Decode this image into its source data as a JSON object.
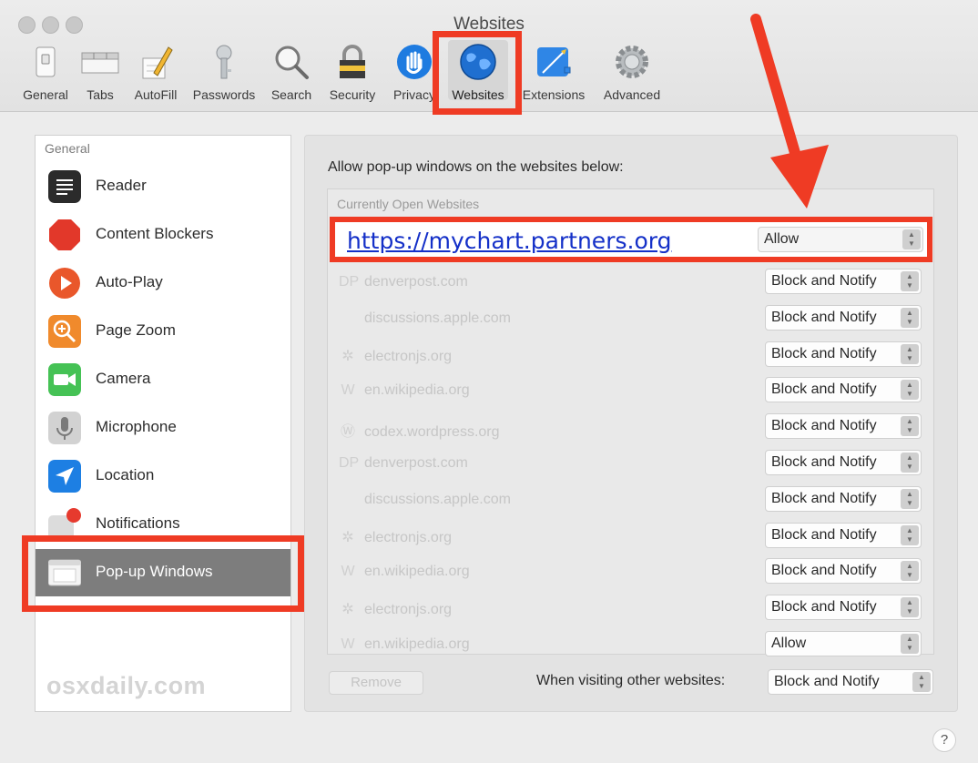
{
  "window": {
    "title": "Websites"
  },
  "toolbar": {
    "items": [
      {
        "label": "General",
        "icon": "general-switch-icon"
      },
      {
        "label": "Tabs",
        "icon": "tabs-icon"
      },
      {
        "label": "AutoFill",
        "icon": "pencil-form-icon"
      },
      {
        "label": "Passwords",
        "icon": "key-icon"
      },
      {
        "label": "Search",
        "icon": "magnifier-icon"
      },
      {
        "label": "Security",
        "icon": "lock-icon"
      },
      {
        "label": "Privacy",
        "icon": "hand-icon"
      },
      {
        "label": "Websites",
        "icon": "globe-icon",
        "selected": true
      },
      {
        "label": "Extensions",
        "icon": "puzzle-compass-icon"
      },
      {
        "label": "Advanced",
        "icon": "gear-icon"
      }
    ]
  },
  "sidebar": {
    "header": "General",
    "items": [
      {
        "label": "Reader",
        "icon": "reader-icon",
        "color": "#2b2b2b"
      },
      {
        "label": "Content Blockers",
        "icon": "stop-sign-icon",
        "color": "#e2382a"
      },
      {
        "label": "Auto-Play",
        "icon": "play-icon",
        "color": "#e9572b"
      },
      {
        "label": "Page Zoom",
        "icon": "zoom-icon",
        "color": "#f08a2c"
      },
      {
        "label": "Camera",
        "icon": "camera-icon",
        "color": "#45c255"
      },
      {
        "label": "Microphone",
        "icon": "microphone-icon",
        "color": "#c9c9c9"
      },
      {
        "label": "Location",
        "icon": "location-arrow-icon",
        "color": "#1d7fe3"
      },
      {
        "label": "Notifications",
        "icon": "notification-badge-icon",
        "color": "#d8d8d8"
      },
      {
        "label": "Pop-up Windows",
        "icon": "window-icon",
        "color": "#f4f4f4",
        "selected": true
      }
    ],
    "watermark": "osxdaily.com"
  },
  "main": {
    "description": "Allow pop-up windows on the websites below:",
    "table_header": "Currently Open Websites",
    "highlighted": {
      "url": "https://mychart.partners.org",
      "setting": "Allow"
    },
    "rows": [
      {
        "site": "denverpost.com",
        "icon": "dp-icon",
        "glyph": "DP",
        "setting": "Block and Notify"
      },
      {
        "site": "discussions.apple.com",
        "icon": "apple-icon",
        "glyph": "",
        "setting": "Block and Notify"
      },
      {
        "site": "electronjs.org",
        "icon": "atom-icon",
        "glyph": "✲",
        "setting": "Block and Notify"
      },
      {
        "site": "en.wikipedia.org",
        "icon": "wikipedia-icon",
        "glyph": "W",
        "setting": "Block and Notify"
      },
      {
        "site": "codex.wordpress.org",
        "icon": "wordpress-icon",
        "glyph": "Ⓦ",
        "setting": "Block and Notify"
      },
      {
        "site": "denverpost.com",
        "icon": "dp-icon",
        "glyph": "DP",
        "setting": "Block and Notify"
      },
      {
        "site": "discussions.apple.com",
        "icon": "apple-icon",
        "glyph": "",
        "setting": "Block and Notify"
      },
      {
        "site": "electronjs.org",
        "icon": "atom-icon",
        "glyph": "✲",
        "setting": "Block and Notify"
      },
      {
        "site": "en.wikipedia.org",
        "icon": "wikipedia-icon",
        "glyph": "W",
        "setting": "Block and Notify"
      },
      {
        "site": "electronjs.org",
        "icon": "atom-icon",
        "glyph": "✲",
        "setting": "Block and Notify"
      },
      {
        "site": "en.wikipedia.org",
        "icon": "wikipedia-icon",
        "glyph": "W",
        "setting": "Allow"
      }
    ],
    "remove_label": "Remove",
    "visiting_label": "When visiting other websites:",
    "visiting_value": "Block and Notify"
  },
  "help_label": "?",
  "colors": {
    "annotation_red": "#ef3b24",
    "link_blue": "#1430c8",
    "selection_gray": "#7d7d7d"
  }
}
